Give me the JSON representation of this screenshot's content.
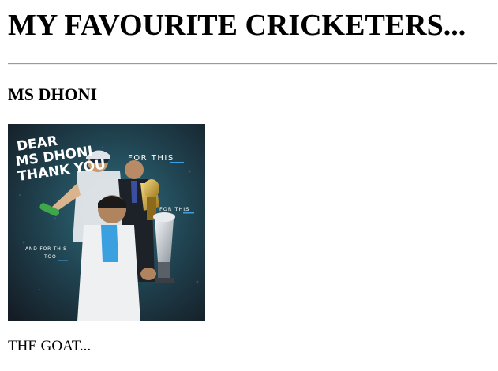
{
  "page": {
    "title": "MY FAVOURITE CRICKETERS...",
    "player_name": "MS DHONI",
    "caption": "THE GOAT..."
  },
  "image": {
    "headline_lines": [
      "DEAR",
      "MS DHONI",
      "THANK YOU"
    ],
    "label_1": "FOR THIS",
    "label_2": "FOR THIS",
    "label_3_lines": [
      "AND FOR THIS",
      "TOO"
    ],
    "colors": {
      "background_dark": "#1c2530",
      "background_teal": "#2f6d7d",
      "suit_white": "#eef0f2",
      "trophy_gold": "#c9a13a",
      "trophy_silver": "#c6ccd2",
      "accent_blue": "#3aa0e0"
    }
  }
}
